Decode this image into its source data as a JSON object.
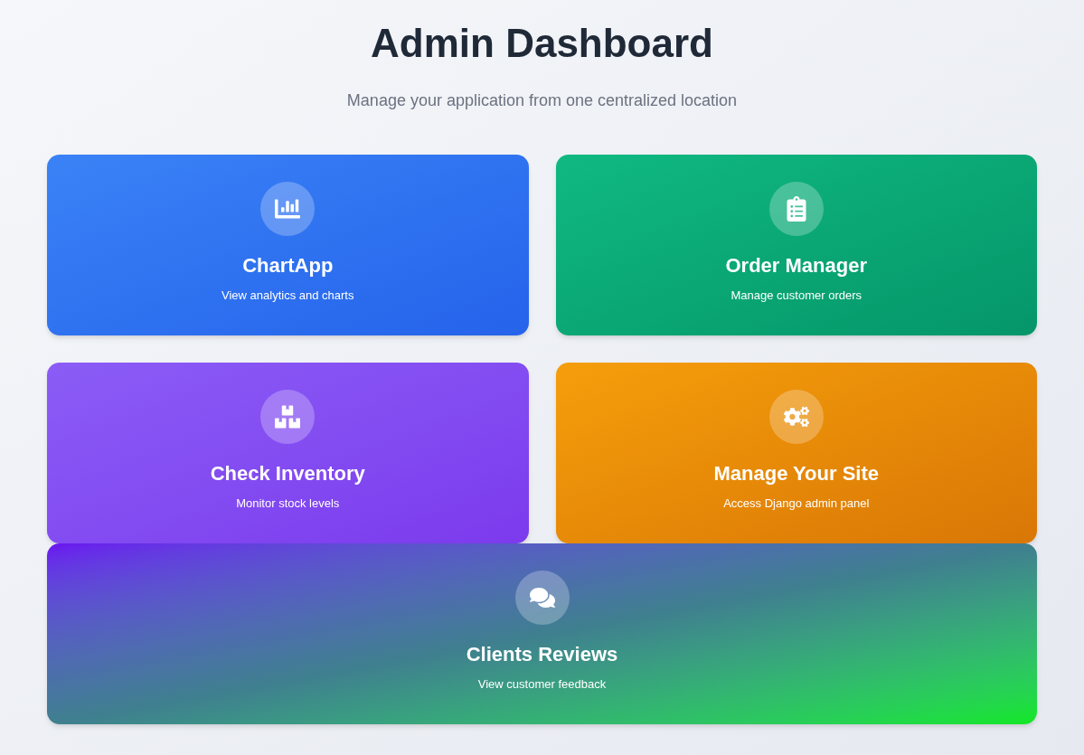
{
  "header": {
    "title": "Admin Dashboard",
    "subtitle": "Manage your application from one centralized location"
  },
  "cards": [
    {
      "kind": "analytics",
      "title": "ChartApp",
      "description": "View analytics and charts"
    },
    {
      "kind": "orders",
      "title": "Order Manager",
      "description": "Manage customer orders"
    },
    {
      "kind": "inventory",
      "title": "Check Inventory",
      "description": "Monitor stock levels"
    },
    {
      "kind": "settings",
      "title": "Manage Your Site",
      "description": "Access Django admin panel"
    },
    {
      "kind": "reviews",
      "title": "Clients Reviews",
      "description": "View customer feedback"
    }
  ]
}
